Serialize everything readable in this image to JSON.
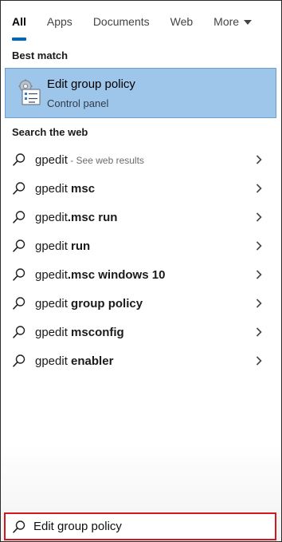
{
  "tabs": [
    {
      "label": "All",
      "active": true
    },
    {
      "label": "Apps",
      "active": false
    },
    {
      "label": "Documents",
      "active": false
    },
    {
      "label": "Web",
      "active": false
    },
    {
      "label": "More",
      "active": false
    }
  ],
  "best_match": {
    "heading": "Best match",
    "title": "Edit group policy",
    "subtitle": "Control panel",
    "icon": "group-policy-icon"
  },
  "web": {
    "heading": "Search the web",
    "results": [
      {
        "prefix": "gpedit",
        "bold": "",
        "suffix": " - See web results"
      },
      {
        "prefix": "gpedit ",
        "bold": "msc",
        "suffix": ""
      },
      {
        "prefix": "gpedit",
        "bold": ".msc run",
        "suffix": ""
      },
      {
        "prefix": "gpedit ",
        "bold": "run",
        "suffix": ""
      },
      {
        "prefix": "gpedit",
        "bold": ".msc windows 10",
        "suffix": ""
      },
      {
        "prefix": "gpedit ",
        "bold": "group policy",
        "suffix": ""
      },
      {
        "prefix": "gpedit ",
        "bold": "msconfig",
        "suffix": ""
      },
      {
        "prefix": "gpedit ",
        "bold": "enabler",
        "suffix": ""
      }
    ]
  },
  "search": {
    "value": "Edit group policy",
    "highlight_color": "#d4161f"
  },
  "colors": {
    "accent": "#0067c0",
    "selected_bg": "#9ec5ea"
  }
}
